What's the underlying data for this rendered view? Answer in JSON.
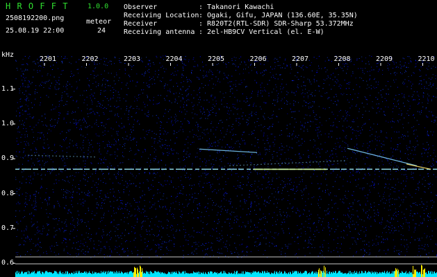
{
  "header": {
    "app_name": "H R O F F T",
    "version": "1.0.0",
    "filename": "2508192200.png",
    "datetime": "25.08.19 22:00",
    "mode_label": "meteor",
    "count": "24",
    "info_labels": [
      "Observer",
      "Receiving Location",
      "Receiver",
      "Receiving antenna"
    ],
    "info_values": [
      ": Takanori Kawachi",
      ": Ogaki, Gifu, JAPAN (136.60E, 35.35N)",
      ": R820T2(RTL-SDR) SDR-Sharp 53.372MHz",
      ": 2el-HB9CV Vertical (el. E-W)"
    ]
  },
  "plot": {
    "y_unit": "kHz",
    "x_ticks": [
      "2201",
      "2202",
      "2203",
      "2204",
      "2205",
      "2206",
      "2207",
      "2208",
      "2209",
      "2210"
    ],
    "y_ticks": [
      "1.1",
      "1.0",
      "0.9",
      "0.8",
      "0.7",
      "0.6"
    ]
  },
  "colors": {
    "background": "#000000",
    "noise": "#1428c8",
    "header_green": "#2fe02f",
    "signal": "#9ef0ff",
    "level_bars": "#00e5ff",
    "level_peaks": "#ffee00"
  }
}
